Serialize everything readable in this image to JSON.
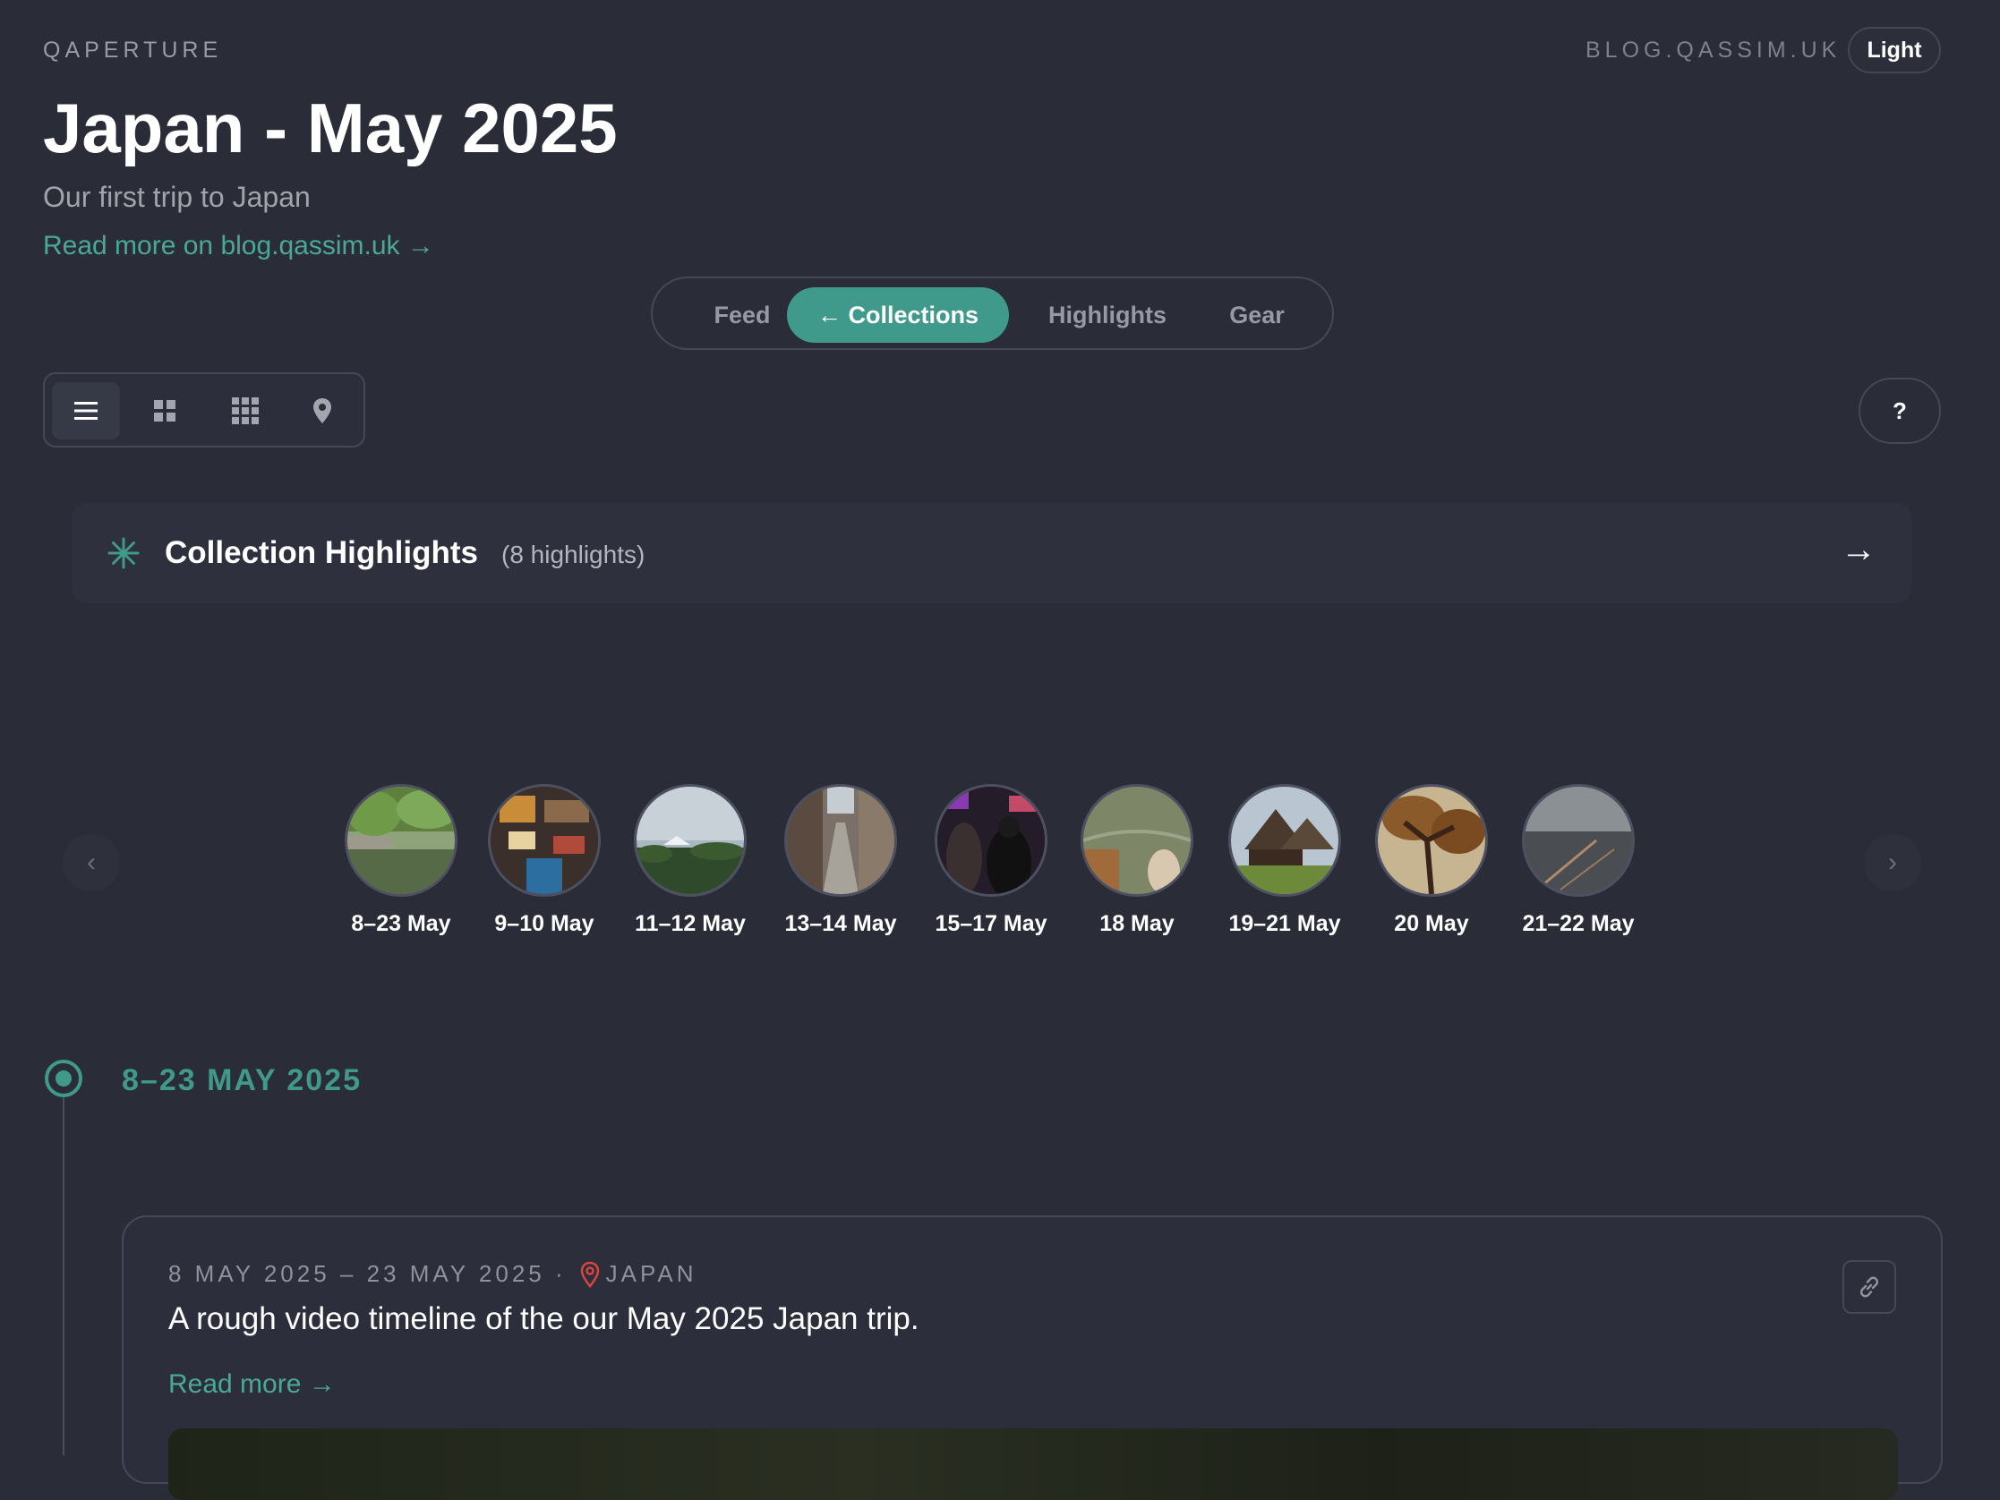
{
  "header": {
    "brand": "QAPERTURE",
    "site": "BLOG.QASSIM.UK",
    "theme_toggle": "Light"
  },
  "page": {
    "title": "Japan - May 2025",
    "subtitle": "Our first trip to Japan",
    "read_more": "Read more on blog.qassim.uk →"
  },
  "tabs": [
    {
      "label": "Feed",
      "active": false
    },
    {
      "label": "← Collections",
      "active": true
    },
    {
      "label": "Highlights",
      "active": false
    },
    {
      "label": "Gear",
      "active": false
    }
  ],
  "view_modes": [
    {
      "icon": "list-icon",
      "active": true
    },
    {
      "icon": "grid-small-icon",
      "active": false
    },
    {
      "icon": "grid-dense-icon",
      "active": false
    },
    {
      "icon": "map-pin-icon",
      "active": false
    }
  ],
  "help_label": "?",
  "highlights_card": {
    "title": "Collection Highlights",
    "count": "(8 highlights)",
    "arrow": "→"
  },
  "carousel": {
    "prev": "‹",
    "next": "›",
    "items": [
      {
        "label": "8–23 May"
      },
      {
        "label": "9–10 May"
      },
      {
        "label": "11–12 May"
      },
      {
        "label": "13–14 May"
      },
      {
        "label": "15–17 May"
      },
      {
        "label": "18 May"
      },
      {
        "label": "19–21 May"
      },
      {
        "label": "20 May"
      },
      {
        "label": "21–22 May"
      }
    ]
  },
  "timeline": {
    "heading": "8–23 MAY 2025"
  },
  "post": {
    "dates": "8 MAY 2025 – 23 MAY 2025 ·",
    "location": "JAPAN",
    "text": "A rough video timeline of the our May 2025 Japan trip.",
    "read_more": "Read more →"
  },
  "colors": {
    "background": "#2a2d38",
    "accent": "#3f9a8b",
    "location_pin": "#d9453d"
  }
}
